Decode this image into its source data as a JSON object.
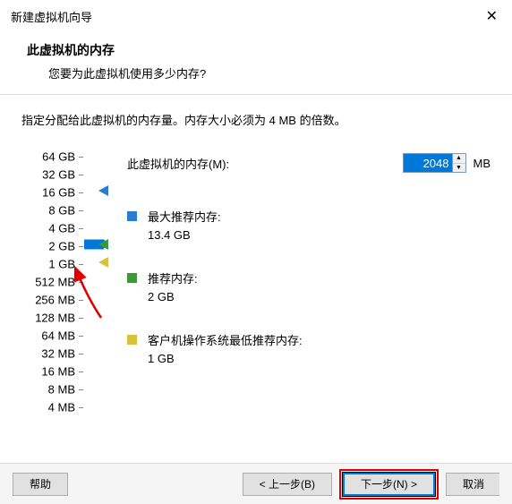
{
  "titlebar": {
    "title": "新建虚拟机向导"
  },
  "header": {
    "title": "此虚拟机的内存",
    "subtitle": "您要为此虚拟机使用多少内存?"
  },
  "instruction": "指定分配给此虚拟机的内存量。内存大小必须为 4 MB 的倍数。",
  "memory": {
    "label": "此虚拟机的内存(M):",
    "value": "2048",
    "unit": "MB"
  },
  "scale": [
    "64 GB",
    "32 GB",
    "16 GB",
    "8 GB",
    "4 GB",
    "2 GB",
    "1 GB",
    "512 MB",
    "256 MB",
    "128 MB",
    "64 MB",
    "32 MB",
    "16 MB",
    "8 MB",
    "4 MB"
  ],
  "info": {
    "max": {
      "label": "最大推荐内存:",
      "value": "13.4 GB",
      "color": "#2a7cd0"
    },
    "rec": {
      "label": "推荐内存:",
      "value": "2 GB",
      "color": "#3a9b35"
    },
    "min": {
      "label": "客户机操作系统最低推荐内存:",
      "value": "1 GB",
      "color": "#d9c23a"
    }
  },
  "footer": {
    "help": "帮助",
    "back": "< 上一步(B)",
    "next": "下一步(N) >",
    "cancel": "取消"
  }
}
